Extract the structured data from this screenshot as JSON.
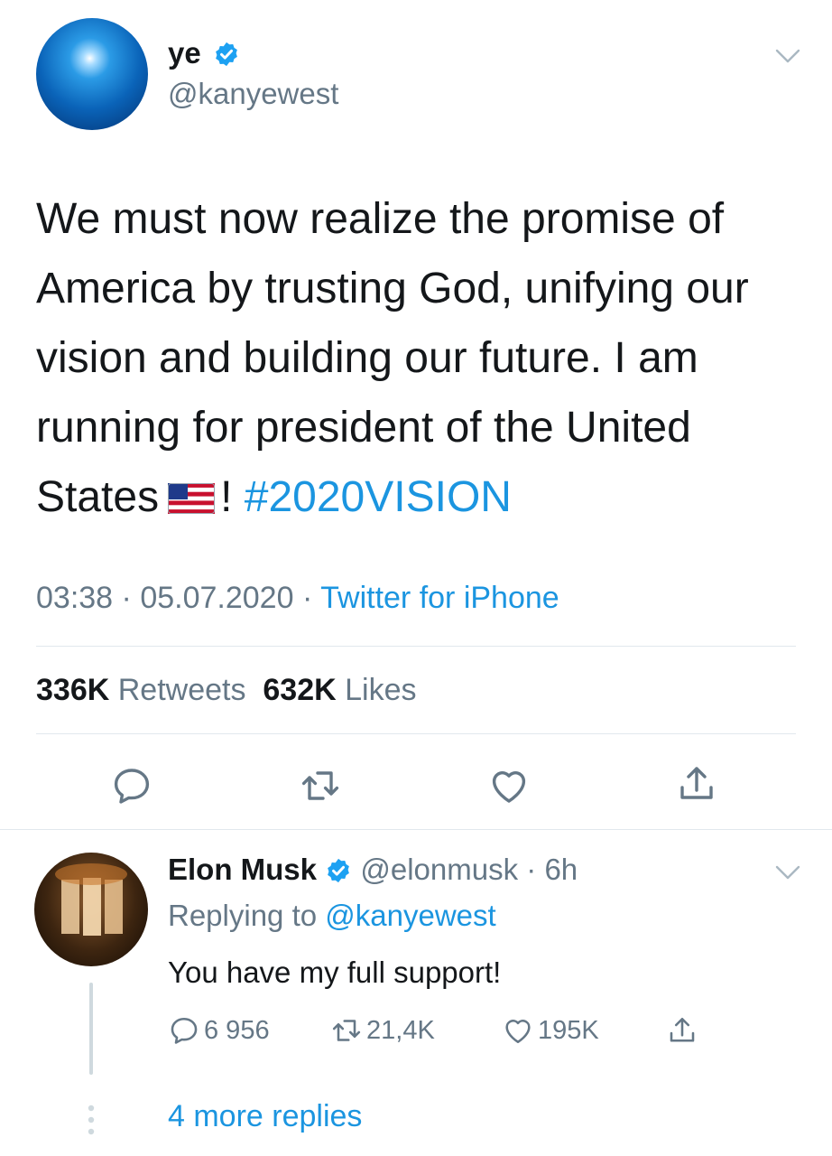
{
  "main_tweet": {
    "author_name": "ye",
    "author_handle": "@kanyewest",
    "text_before_flag": "We must now realize the promise of America by trusting God, unifying our vision and building our future. I am running for president of the United States",
    "text_after_flag": "!",
    "hashtag": "#2020VISION",
    "time": "03:38",
    "separator": "·",
    "date": "05.07.2020",
    "source": "Twitter for iPhone",
    "retweets_count": "336K",
    "retweets_label": "Retweets",
    "likes_count": "632K",
    "likes_label": "Likes"
  },
  "reply": {
    "author_name": "Elon Musk",
    "author_handle": "@elonmusk",
    "age": "6h",
    "replying_label": "Replying to",
    "replying_handle": "@kanyewest",
    "text": "You have my full support!",
    "reply_count": "6 956",
    "retweet_count": "21,4K",
    "like_count": "195K"
  },
  "more_replies": "4 more replies",
  "colors": {
    "accent": "#1b95e0",
    "secondary_text": "#657786",
    "divider": "#e1e8ed",
    "verified": "#1da1f2"
  },
  "icons": {
    "verified": "verified-badge-icon",
    "chevron": "chevron-down-icon",
    "reply": "reply-icon",
    "retweet": "retweet-icon",
    "like": "heart-icon",
    "share": "share-icon",
    "flag": "us-flag-emoji"
  }
}
